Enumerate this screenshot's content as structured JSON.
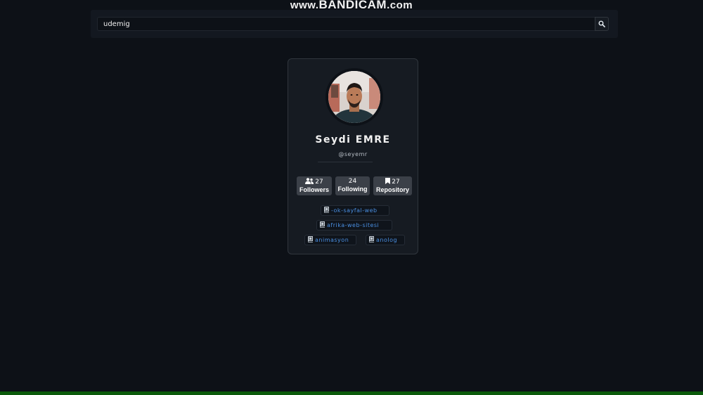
{
  "watermark": {
    "prefix": "www.",
    "brand": "BANDICAM",
    "suffix": ".com"
  },
  "search": {
    "value": "udemig",
    "placeholder": ""
  },
  "profile": {
    "name": "Seydi EMRE",
    "handle": "@seyemr",
    "stats": {
      "followers": {
        "count": "27",
        "label": "Followers"
      },
      "following": {
        "count": "24",
        "label": "Following"
      },
      "repository": {
        "count": "27",
        "label": "Repository"
      }
    },
    "repos": [
      "-ok-sayfal-web",
      "afrika-web-sitesi",
      "animasyon",
      "anolog"
    ]
  },
  "colors": {
    "background": "#0d1117",
    "card": "#161b22",
    "stat_badge": "#3b4048",
    "repo_link": "#4a8fe2",
    "bottom_bar": "#0b5a0b"
  },
  "icons": {
    "search_button": "search-icon",
    "followers": "people-icon",
    "repository": "bookmark-icon",
    "repo_item": "repo-book-icon"
  }
}
